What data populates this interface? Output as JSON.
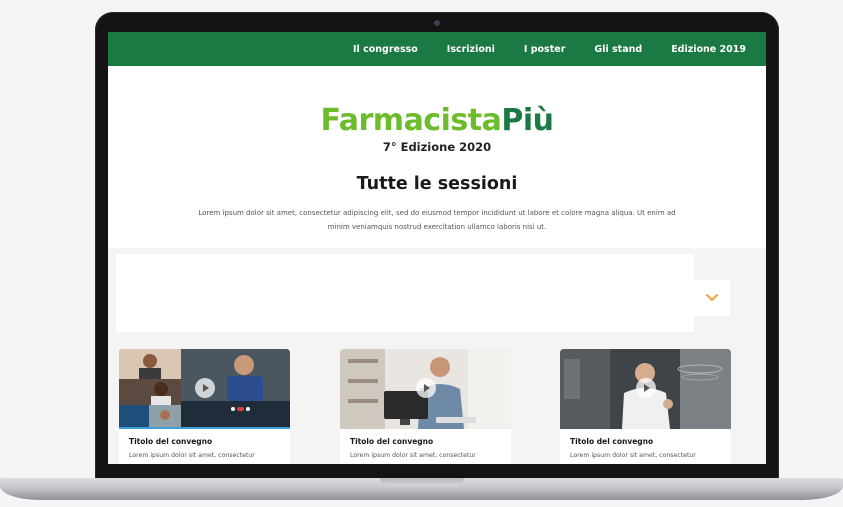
{
  "nav": {
    "items": [
      "Il congresso",
      "Iscrizioni",
      "I poster",
      "Gli stand",
      "Edizione 2019"
    ]
  },
  "hero": {
    "logo_part1": "Farmacista",
    "logo_part2": "Più",
    "edition": "7° Edizione 2020",
    "title": "Tutte le sessioni",
    "intro": "Lorem ipsum dolor sit amet, consectetur adipiscing elit, sed do eiusmod tempor incididunt ut labore et colore magna aliqua. Ut enim ad minim veniamquis nostrud exercitation ullamco laboris nisi ut."
  },
  "filter": {
    "dropdown_icon": "chevron-down-icon"
  },
  "cards": [
    {
      "title": "Titolo del convegno",
      "desc": "Lorem ipsum dolor sit amet, consectetur",
      "thumb": "video-call-grid",
      "play_icon": "play-icon"
    },
    {
      "title": "Titolo del convegno",
      "desc": "Lorem ipsum dolor sit amet, consectetur",
      "thumb": "man-at-computer",
      "play_icon": "play-icon"
    },
    {
      "title": "Titolo del convegno",
      "desc": "Lorem ipsum dolor sit amet, consectetur",
      "thumb": "man-speaking",
      "play_icon": "play-icon"
    }
  ],
  "colors": {
    "nav_bg": "#1b7a43",
    "logo_light_green": "#6cbc2b",
    "logo_dark_green": "#1b7a43",
    "chevron": "#f2a23a"
  }
}
